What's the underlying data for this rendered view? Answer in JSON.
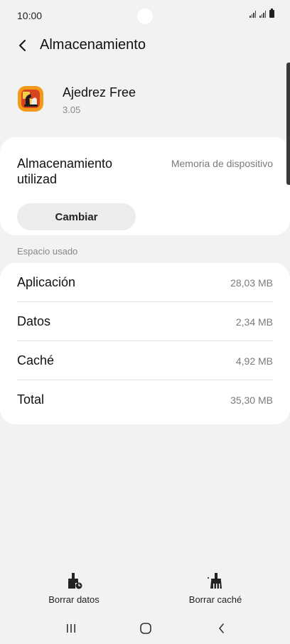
{
  "status_bar": {
    "time": "10:00"
  },
  "header": {
    "title": "Almacenamiento"
  },
  "app": {
    "name": "Ajedrez Free",
    "version": "3.05"
  },
  "storage": {
    "label": "Almacenamiento utilizad",
    "location": "Memoria de dispositivo",
    "change_button": "Cambiar"
  },
  "usage": {
    "section_title": "Espacio usado",
    "rows": [
      {
        "label": "Aplicación",
        "value": "28,03 MB"
      },
      {
        "label": "Datos",
        "value": "2,34 MB"
      },
      {
        "label": "Caché",
        "value": "4,92 MB"
      },
      {
        "label": "Total",
        "value": "35,30 MB"
      }
    ]
  },
  "actions": {
    "clear_data": {
      "label": "Borrar datos",
      "icon": "broom-data-icon"
    },
    "clear_cache": {
      "label": "Borrar caché",
      "icon": "broom-cache-icon"
    }
  },
  "colors": {
    "background": "#f2f2f2",
    "card": "#ffffff",
    "button": "#ececec"
  }
}
